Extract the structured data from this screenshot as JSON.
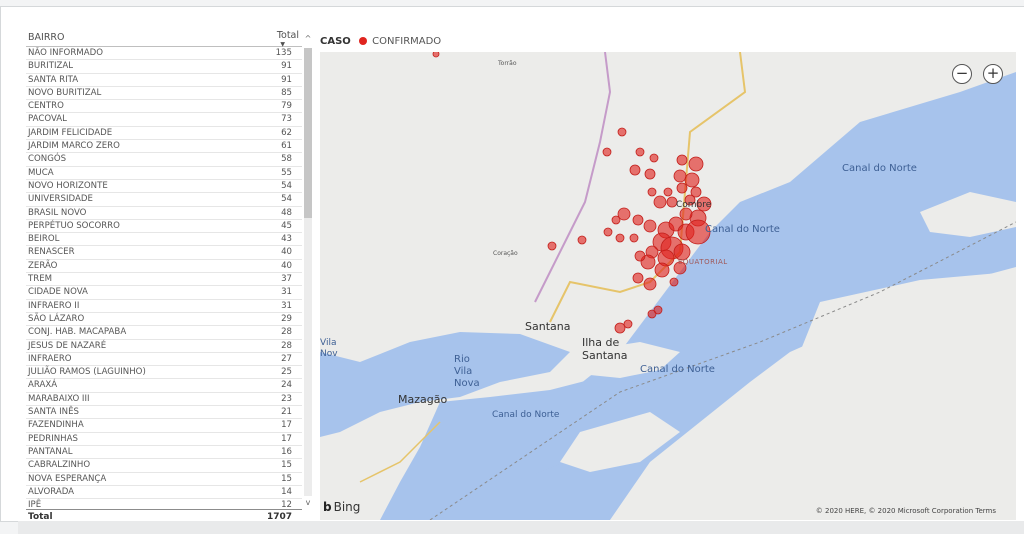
{
  "table": {
    "header_bairro": "BAIRRO",
    "header_total": "Total",
    "rows": [
      {
        "name": "NÃO INFORMADO",
        "total": "135"
      },
      {
        "name": "BURITIZAL",
        "total": "91"
      },
      {
        "name": "SANTA RITA",
        "total": "91"
      },
      {
        "name": "NOVO BURITIZAL",
        "total": "85"
      },
      {
        "name": "CENTRO",
        "total": "79"
      },
      {
        "name": "PACOVAL",
        "total": "73"
      },
      {
        "name": "JARDIM FELICIDADE",
        "total": "62"
      },
      {
        "name": "JARDIM MARCO ZERO",
        "total": "61"
      },
      {
        "name": "CONGÓS",
        "total": "58"
      },
      {
        "name": "MUCA",
        "total": "55"
      },
      {
        "name": "NOVO HORIZONTE",
        "total": "54"
      },
      {
        "name": "UNIVERSIDADE",
        "total": "54"
      },
      {
        "name": "BRASIL NOVO",
        "total": "48"
      },
      {
        "name": "PERPÉTUO SOCORRO",
        "total": "45"
      },
      {
        "name": "BEIROL",
        "total": "43"
      },
      {
        "name": "RENASCER",
        "total": "40"
      },
      {
        "name": "ZERÃO",
        "total": "40"
      },
      {
        "name": "TREM",
        "total": "37"
      },
      {
        "name": "CIDADE NOVA",
        "total": "31"
      },
      {
        "name": "INFRAERO II",
        "total": "31"
      },
      {
        "name": "SÃO LÁZARO",
        "total": "29"
      },
      {
        "name": "CONJ. HAB. MACAPABA",
        "total": "28"
      },
      {
        "name": "JESUS DE NAZARÉ",
        "total": "28"
      },
      {
        "name": "INFRAERO",
        "total": "27"
      },
      {
        "name": "JULIÃO RAMOS (LAGUINHO)",
        "total": "25"
      },
      {
        "name": "ARAXÁ",
        "total": "24"
      },
      {
        "name": "MARABAIXO III",
        "total": "23"
      },
      {
        "name": "SANTA INÊS",
        "total": "21"
      },
      {
        "name": "FAZENDINHA",
        "total": "17"
      },
      {
        "name": "PEDRINHAS",
        "total": "17"
      },
      {
        "name": "PANTANAL",
        "total": "16"
      },
      {
        "name": "CABRALZINHO",
        "total": "15"
      },
      {
        "name": "NOVA ESPERANÇA",
        "total": "15"
      },
      {
        "name": "ALVORADA",
        "total": "14"
      },
      {
        "name": "IPÊ",
        "total": "12"
      }
    ],
    "footer_label": "Total",
    "footer_total": "1707"
  },
  "legend": {
    "title": "CASO",
    "item": "CONFIRMADO",
    "color": "#e0241f"
  },
  "map": {
    "zoom_out": "−",
    "zoom_in": "+",
    "attribution_brand": "Bing",
    "copyright": "© 2020 HERE, © 2020 Microsoft Corporation Terms",
    "labels": {
      "canal_norte_1": "Canal do Norte",
      "canal_norte_2": "Canal do Norte",
      "canal_norte_3": "Canal do Norte",
      "canal_norte_4": "Canal do Norte",
      "santana": "Santana",
      "ilha_santana": "Ilha de Santana",
      "mazagao": "Mazagão",
      "rio_vila_nova": "Rio Vila Nova",
      "vila_nova_left": "Vila Nova",
      "equatorial": "EQUATORIAL",
      "combre": "Combre",
      "coracao": "Coração",
      "torrao": "Torrão"
    },
    "colors": {
      "water": "#a7c3ec",
      "land": "#ececea",
      "bubble": "#e0241f"
    }
  }
}
